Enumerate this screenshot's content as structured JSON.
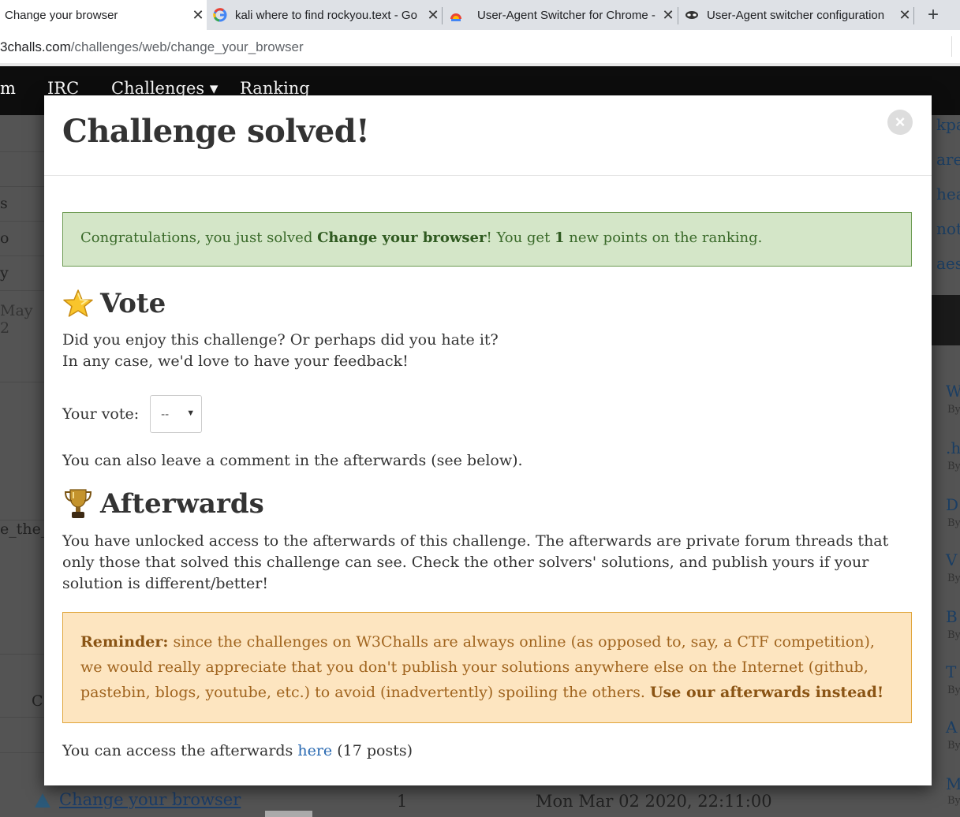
{
  "browser": {
    "tabs": [
      {
        "title": "Change your browser",
        "active": true
      },
      {
        "title": "kali where to find rockyou.text - Go",
        "active": false
      },
      {
        "title": "User-Agent Switcher for Chrome - ",
        "active": false
      },
      {
        "title": "User-Agent switcher configuration",
        "active": false
      }
    ],
    "new_tab": "+",
    "close_glyph": "✕",
    "address": {
      "host": "3challs.com",
      "path": "/challenges/web/change_your_browser"
    }
  },
  "navbar": {
    "items": [
      "m",
      "IRC",
      "Challenges ▾",
      "Ranking"
    ]
  },
  "background": {
    "left_snippets": [
      "s",
      "o",
      "y",
      "May 2",
      "e_the_",
      "C"
    ],
    "right_snippets": [
      "kpa",
      "are",
      "hea",
      "not",
      "aes",
      "W",
      ".h",
      "D",
      "V",
      "B",
      "T",
      "A",
      "M"
    ],
    "right_by": "By",
    "bottom_row": {
      "name": "Change your browser",
      "count": "1",
      "date": "Mon Mar 02 2020, 22:11:00"
    }
  },
  "modal": {
    "title": "Challenge solved!",
    "close_label": "×",
    "success": {
      "prefix": "Congratulations, you just solved ",
      "challenge": "Change your browser",
      "middle": "! You get ",
      "points": "1",
      "suffix": " new points on the ranking."
    },
    "vote": {
      "heading": "Vote",
      "line1": "Did you enjoy this challenge? Or perhaps did you hate it?",
      "line2": "In any case, we'd love to have your feedback!",
      "label": "Your vote:",
      "selected": "--",
      "comment_note": "You can also leave a comment in the afterwards (see below)."
    },
    "afterwards": {
      "heading": "Afterwards",
      "description": "You have unlocked access to the afterwards of this challenge. The afterwards are private forum threads that only those that solved this challenge can see. Check the other solvers' solutions, and publish yours if your solution is different/better!",
      "reminder_label": "Reminder:",
      "reminder_text": " since the challenges on W3Challs are always online (as opposed to, say, a CTF competition), we would really appreciate that you don't publish your solutions anywhere else on the Internet (github, pastebin, blogs, youtube, etc.) to avoid (inadvertently) spoiling the others. ",
      "reminder_emphasis": "Use our afterwards instead!",
      "access_prefix": "You can access the afterwards ",
      "access_link": "here",
      "access_suffix": " (17 posts)"
    }
  }
}
